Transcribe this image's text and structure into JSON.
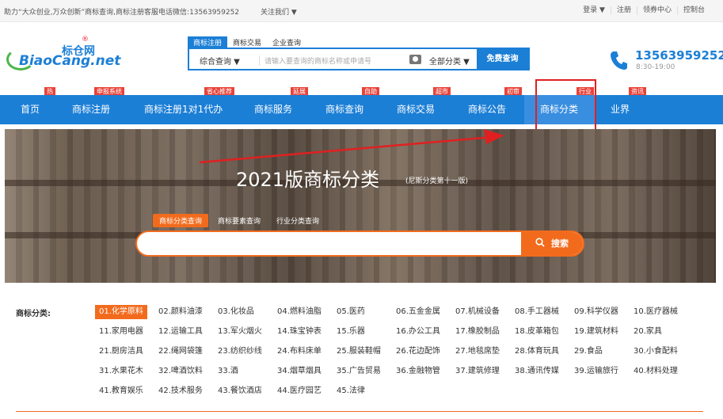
{
  "topbar": {
    "slogan": "助力“大众创业,万众创新”商标查询,商标注册客服电话微信:13563959252",
    "follow": "关注我们 ▼",
    "links": [
      "登录 ▼",
      "注册",
      "领券中心",
      "控制台"
    ]
  },
  "logo": {
    "cn": "标仓网",
    "en": "BiaoCang.net",
    "reg": "®"
  },
  "search": {
    "tabs": [
      "商标注册",
      "商标交易",
      "企业查询"
    ],
    "scope": "综合查询 ▼",
    "placeholder": "请输入要查询的商标名称或申请号",
    "category": "全部分类 ▼",
    "button": "免费查询"
  },
  "contact": {
    "phone": "13563959252",
    "hours": "8:30-19:00"
  },
  "nav": {
    "items": [
      "首页",
      "商标注册",
      "商标注册1对1代办",
      "商标服务",
      "商标查询",
      "商标交易",
      "商标公告",
      "商标分类",
      "业界"
    ],
    "badges": [
      "热",
      "申报系统",
      "省心推荐",
      "延展",
      "自助",
      "超市",
      "初审",
      "行业",
      "资讯"
    ]
  },
  "banner": {
    "title": "2021版商标分类",
    "subtitle": "(尼斯分类第十一版)",
    "tabs": [
      "商标分类查询",
      "商标要素查询",
      "行业分类查询"
    ],
    "search_button": "搜索",
    "search_icon": "magnifier-icon"
  },
  "categories": {
    "label": "商标分类:",
    "items": [
      "01.化学原料",
      "02.颜料油漆",
      "03.化妆品",
      "04.燃料油脂",
      "05.医药",
      "06.五金金属",
      "07.机械设备",
      "08.手工器械",
      "09.科学仪器",
      "10.医疗器械",
      "11.家用电器",
      "12.运输工具",
      "13.军火烟火",
      "14.珠宝钟表",
      "15.乐器",
      "16.办公工具",
      "17.橡胶制品",
      "18.皮革箱包",
      "19.建筑材料",
      "20.家具",
      "21.厨房洁具",
      "22.绳网袋篷",
      "23.纺织纱线",
      "24.布料床单",
      "25.服装鞋帽",
      "26.花边配饰",
      "27.地毯席垫",
      "28.体育玩具",
      "29.食品",
      "30.小食配料",
      "31.水果花木",
      "32.啤酒饮料",
      "33.酒",
      "34.烟草烟具",
      "35.广告贸易",
      "36.金融物管",
      "37.建筑修理",
      "38.通讯传媒",
      "39.运输旅行",
      "40.材料处理",
      "41.教育娱乐",
      "42.技术服务",
      "43.餐饮酒店",
      "44.医疗园艺",
      "45.法律"
    ],
    "active_index": 0
  },
  "colors": {
    "brand": "#1c7fd6",
    "accent": "#f26b1d",
    "badge": "#e8433a",
    "highlight": "#e02020"
  }
}
